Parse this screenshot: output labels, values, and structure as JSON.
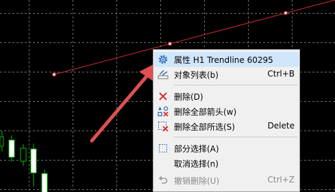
{
  "chart": {
    "background": "#000000",
    "trendline_color": "#d72f2f",
    "bull_candle_color": "#ffffff",
    "bear_candle_color": "#00c000",
    "annotation_arrow_color": "#e05050"
  },
  "context_menu": {
    "items": [
      {
        "label": "属性 H1 Trendline 60295",
        "shortcut": "",
        "icon": "gear-icon",
        "highlighted": true,
        "disabled": false
      },
      {
        "label": "对象列表(b)",
        "shortcut": "Ctrl+B",
        "icon": "objects-list-icon",
        "highlighted": false,
        "disabled": false
      },
      {
        "label": "删除(D)",
        "shortcut": "",
        "icon": "delete-icon",
        "highlighted": false,
        "disabled": false
      },
      {
        "label": "删除全部箭头(w)",
        "shortcut": "",
        "icon": "delete-arrows-icon",
        "highlighted": false,
        "disabled": false
      },
      {
        "label": "删除全部所选(S)",
        "shortcut": "Delete",
        "icon": "delete-selected-icon",
        "highlighted": false,
        "disabled": false
      },
      {
        "label": "部分选择(A)",
        "shortcut": "",
        "icon": "partial-select-icon",
        "highlighted": false,
        "disabled": false
      },
      {
        "label": "取消选择(n)",
        "shortcut": "",
        "icon": "",
        "highlighted": false,
        "disabled": false
      },
      {
        "label": "撤销删除(U)",
        "shortcut": "Ctrl+Z",
        "icon": "undo-icon",
        "highlighted": false,
        "disabled": true
      }
    ]
  }
}
